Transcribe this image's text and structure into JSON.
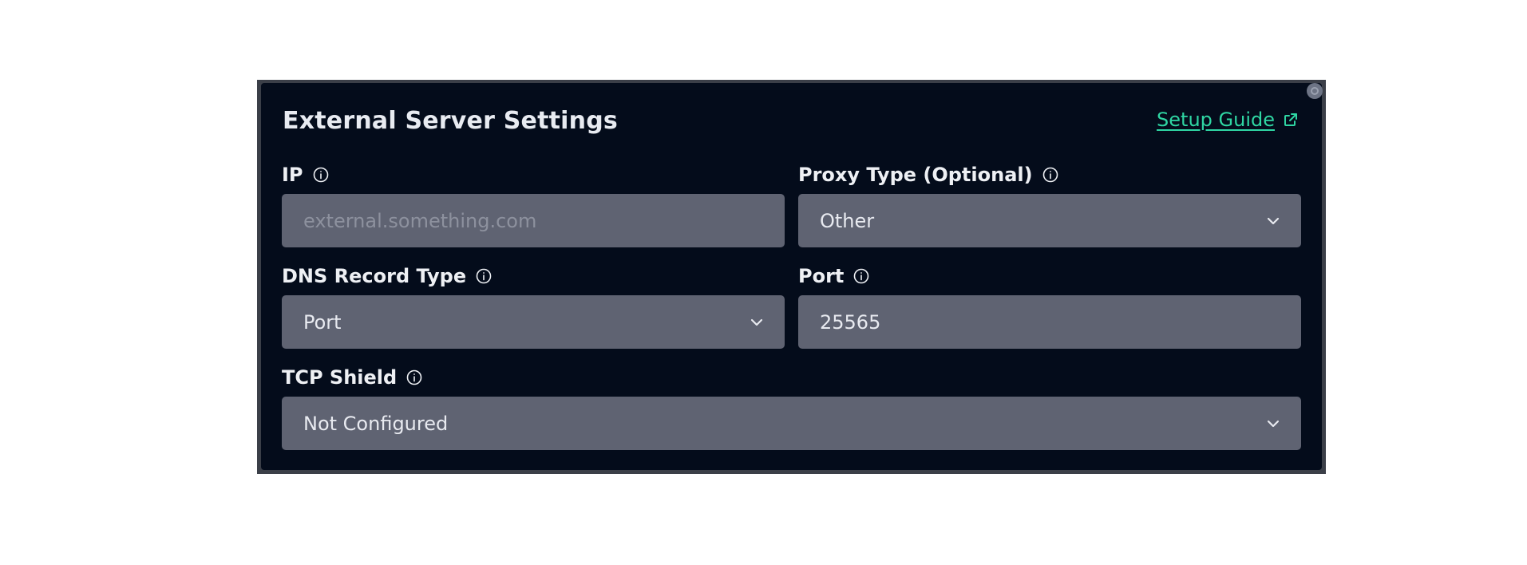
{
  "panel": {
    "title": "External Server Settings",
    "setup_guide_label": "Setup Guide"
  },
  "fields": {
    "ip": {
      "label": "IP",
      "value": "",
      "placeholder": "external.something.com"
    },
    "proxy_type": {
      "label": "Proxy Type (Optional)",
      "selected": "Other"
    },
    "dns_record_type": {
      "label": "DNS Record Type",
      "selected": "Port"
    },
    "port": {
      "label": "Port",
      "value": "25565"
    },
    "tcp_shield": {
      "label": "TCP Shield",
      "selected": "Not Configured"
    }
  },
  "icons": {
    "info": "info-icon",
    "external_link": "external-link-icon",
    "chevron": "chevron-down-icon"
  },
  "colors": {
    "panel_background": "#040c1b",
    "field_background": "#5f6372",
    "accent_link": "#2fd6a3",
    "text": "#eef0f4"
  }
}
